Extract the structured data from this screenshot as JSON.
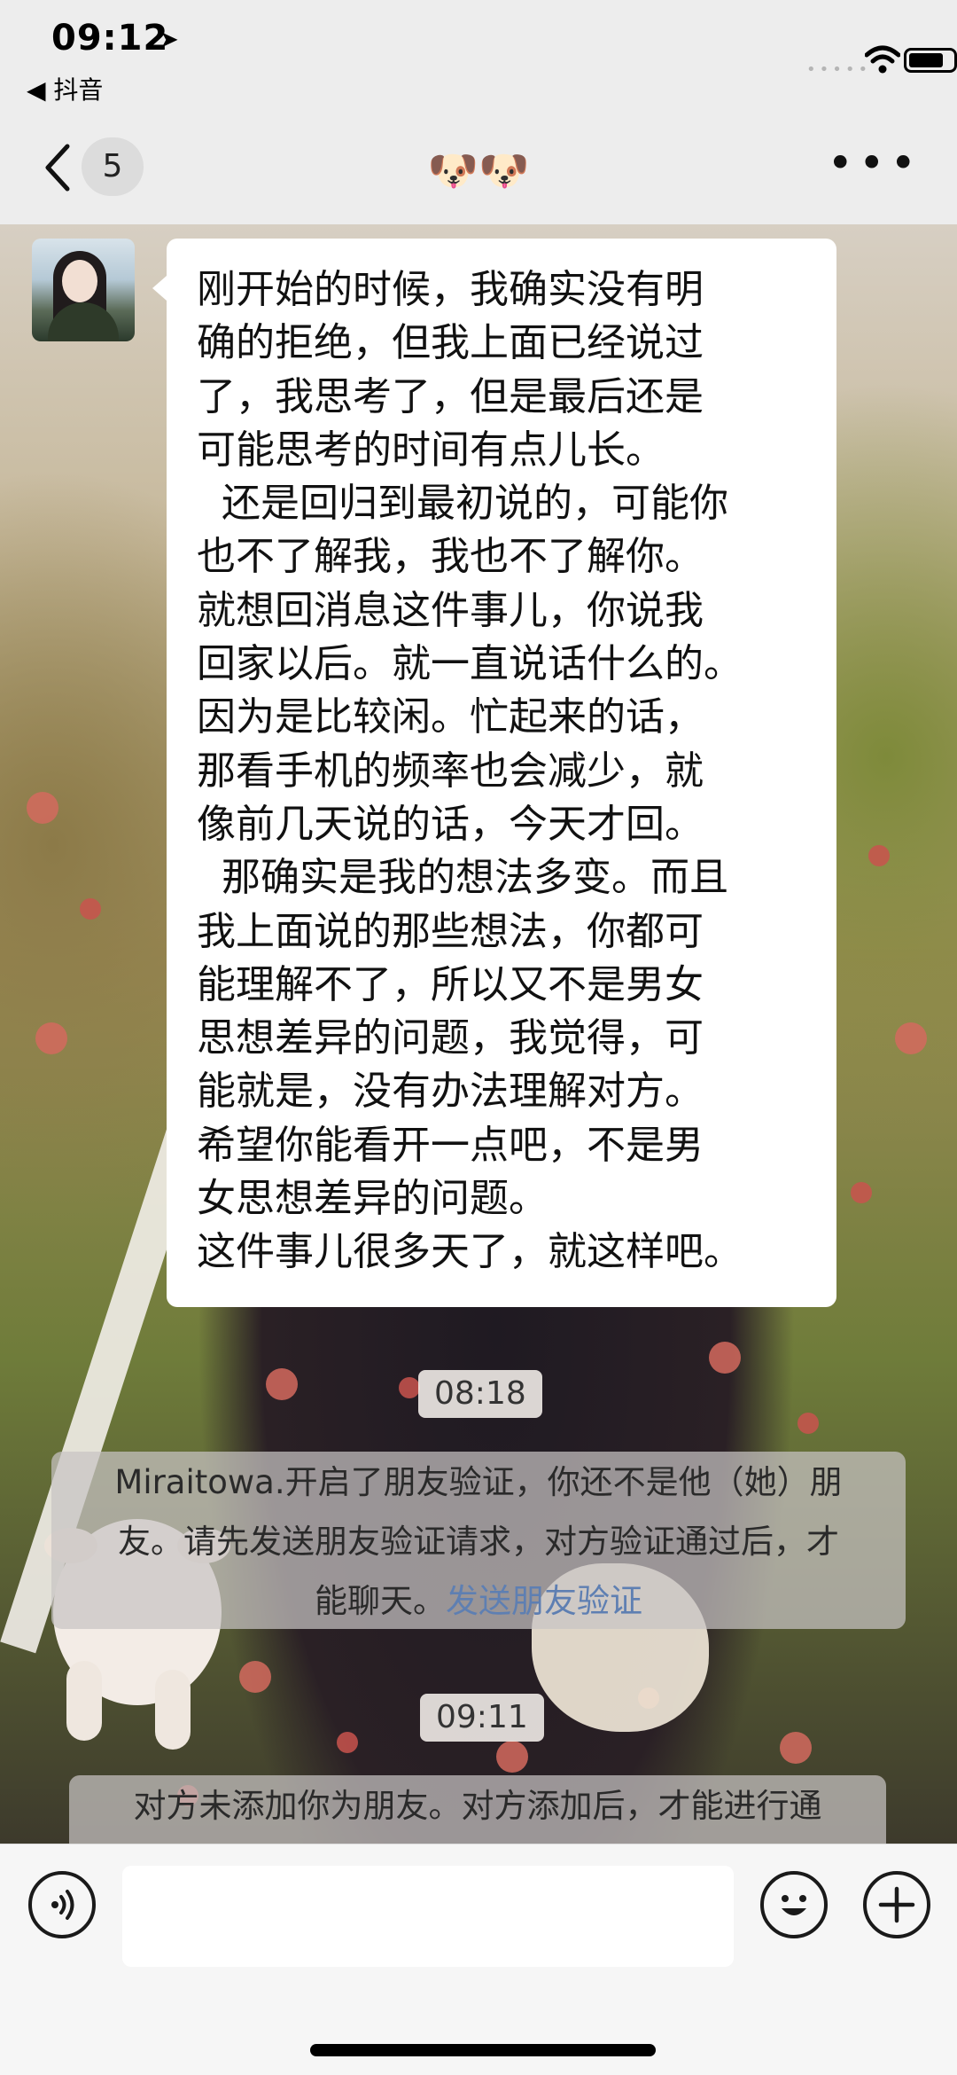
{
  "status_bar": {
    "time": "09:12",
    "back_app": "◀ 抖音",
    "signal_dots": "•••••"
  },
  "nav": {
    "unread_count": "5",
    "title": "🐶🐶",
    "more_label": "•••"
  },
  "message": {
    "lines": [
      "刚开始的时候，我确实没有明",
      "确的拒绝，但我上面已经说过",
      "了，我思考了，但是最后还是",
      "可能思考的时间有点儿长。",
      "  还是回归到最初说的，可能你",
      "也不了解我，我也不了解你。",
      "就想回消息这件事儿，你说我",
      "回家以后。就一直说话什么的。",
      "因为是比较闲。忙起来的话，",
      "那看手机的频率也会减少，就",
      "像前几天说的话，今天才回。",
      "  那确实是我的想法多变。而且",
      "我上面说的那些想法，你都可",
      "能理解不了，所以又不是男女",
      "思想差异的问题，我觉得，可",
      "能就是，没有办法理解对方。",
      "希望你能看开一点吧，不是男",
      "女思想差异的问题。",
      "这件事儿很多天了，就这样吧。"
    ]
  },
  "timestamps": {
    "first": "08:18",
    "second": "09:11"
  },
  "system_notice_1": {
    "line1": "Miraitowa.开启了朋友验证，你还不是他（她）朋",
    "line2": "友。请先发送朋友验证请求，对方验证通过后，才",
    "line3_prefix": "能聊天。",
    "link": "发送朋友验证"
  },
  "system_notice_2": {
    "text": "对方未添加你为朋友。对方添加后，才能进行通"
  },
  "input": {
    "value": "",
    "placeholder": ""
  },
  "status": {
    "battery_level_percent": 80
  },
  "colors": {
    "bar_bg": "#ededed",
    "link": "#5e7fb2"
  }
}
